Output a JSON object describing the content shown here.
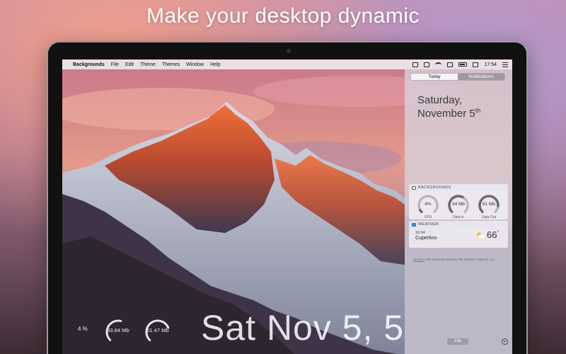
{
  "headline": "Make your desktop dynamic",
  "menubar": {
    "app_name": "Backgrounds",
    "items": [
      "File",
      "Edit",
      "Theme",
      "Themes",
      "Window",
      "Help"
    ],
    "clock": "17:54"
  },
  "desktop": {
    "cpu_percent_label": "4 %",
    "gauges": [
      {
        "value": "33.84 Mb",
        "level": 0.55
      },
      {
        "value": "61.47 Mb",
        "level": 0.75
      }
    ],
    "big_date": "Sat Nov 5, 5"
  },
  "notification_center": {
    "tabs": [
      {
        "label": "Today",
        "active": true
      },
      {
        "label": "Notifications",
        "active": false
      }
    ],
    "day": "Saturday,",
    "date": "November 5",
    "date_suffix": "th",
    "backgrounds_widget": {
      "title": "BACKGROUNDS",
      "gauges": [
        {
          "value": "4%",
          "caption": "CPU",
          "level": 0.05
        },
        {
          "value": "34 Mb",
          "caption": "Data In",
          "level": 0.6
        },
        {
          "value": "61 Mb",
          "caption": "Data Out",
          "level": 0.85
        }
      ]
    },
    "weather_widget": {
      "title": "WEATHER",
      "time": "16:54",
      "city": "Cupertino",
      "temp": "66",
      "temp_unit": "°"
    },
    "credit_link": "Weather",
    "credit_rest": " information provided by The Weather Channel, LLC.",
    "edit_label": "Edit"
  },
  "colors": {
    "gauge_track": "#b8b8bf",
    "gauge_fill": "#6a6a72",
    "desk_gauge": "#e6e6ea"
  }
}
